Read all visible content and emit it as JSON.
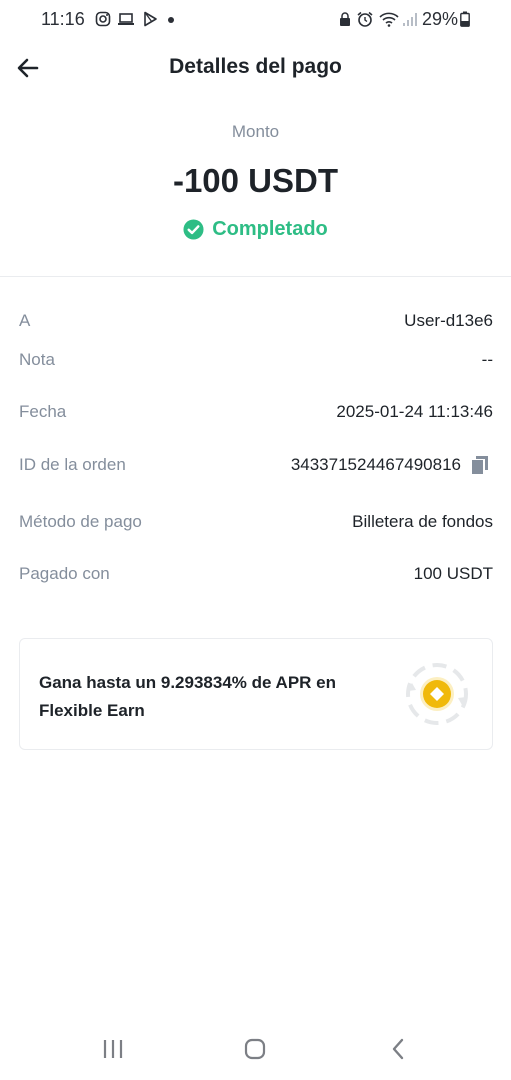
{
  "status_bar": {
    "time": "11:16",
    "battery_percent": "29%"
  },
  "header": {
    "title": "Detalles del pago"
  },
  "amount": {
    "label": "Monto",
    "value": "-100 USDT",
    "status": "Completado"
  },
  "details": [
    {
      "label": "A",
      "value": "User-d13e6"
    },
    {
      "label": "Nota",
      "value": "--"
    },
    {
      "label": "Fecha",
      "value": "2025-01-24 11:13:46"
    },
    {
      "label": "ID de la orden",
      "value": "343371524467490816"
    },
    {
      "label": "Método de pago",
      "value": "Billetera de fondos"
    },
    {
      "label": "Pagado con",
      "value": "100 USDT"
    }
  ],
  "earn_card": {
    "line1": "Gana hasta un 9.293834% de APR en",
    "line2": "Flexible Earn"
  },
  "colors": {
    "success": "#2ebd85",
    "brand_yellow": "#f0b90b",
    "text_primary": "#1e2329",
    "text_secondary": "#848e9c"
  },
  "icons": {
    "back": "arrow-left-icon",
    "status": "check-circle-icon",
    "copy": "copy-icon",
    "earn": "earn-coin-icon"
  }
}
